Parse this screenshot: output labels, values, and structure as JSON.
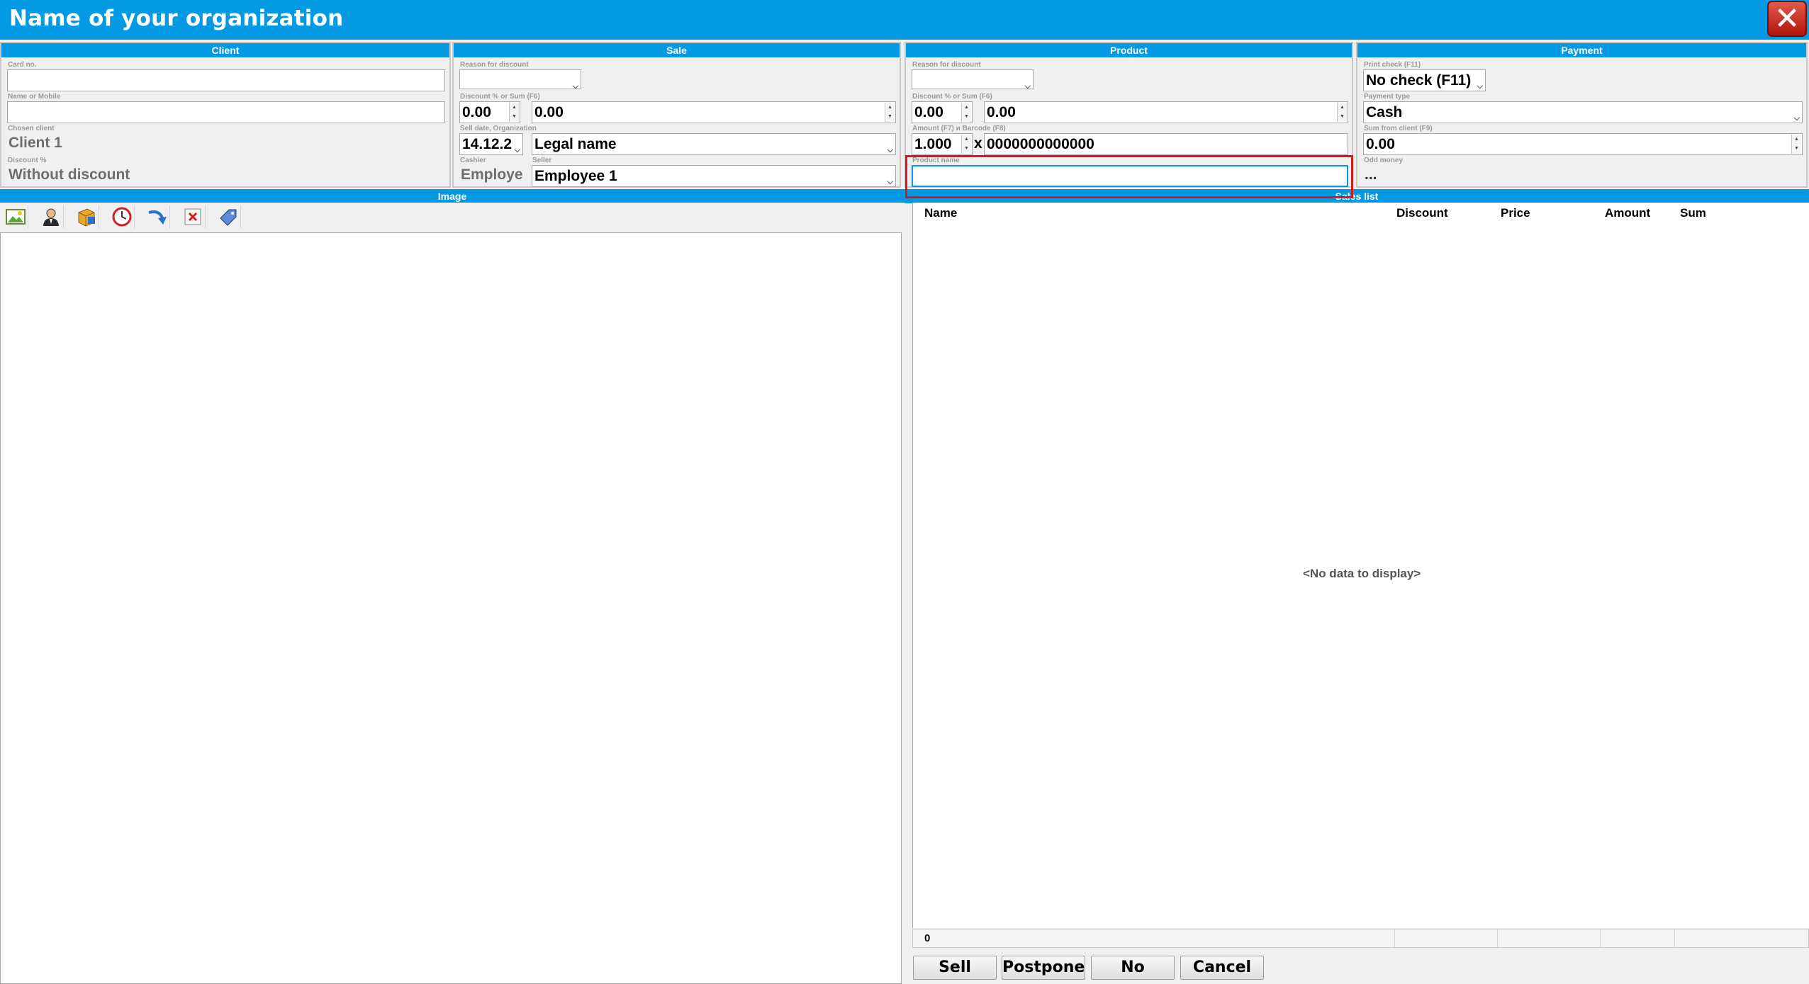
{
  "window": {
    "title": "Name of your organization"
  },
  "client": {
    "header": "Client",
    "card_label": "Card no.",
    "card_value": "",
    "name_label": "Name or Mobile",
    "name_value": "",
    "chosen_label": "Chosen client",
    "chosen_value": "Client 1",
    "discount_label": "Discount %",
    "discount_value": "Without discount"
  },
  "sale": {
    "header": "Sale",
    "reason_label": "Reason for discount",
    "reason_value": "",
    "discount_label": "Discount % or Sum (F6)",
    "discount_pct": "0.00",
    "discount_sum": "0.00",
    "date_label": "Sell date, Organization",
    "date_value": "14.12.2",
    "organization": "Legal name",
    "cashier_label": "Cashier",
    "cashier_value": "Employe",
    "seller_label": "Seller",
    "seller_value": "Employee 1"
  },
  "product": {
    "header": "Product",
    "reason_label": "Reason for discount",
    "reason_value": "",
    "discount_label": "Discount % or Sum (F6)",
    "discount_pct": "0.00",
    "discount_sum": "0.00",
    "amount_label": "Amount (F7) и Barcode (F8)",
    "amount_value": "1.000",
    "times": "x",
    "barcode": "0000000000000",
    "name_label": "Product name",
    "name_value": ""
  },
  "payment": {
    "header": "Payment",
    "print_label": "Print check (F11)",
    "print_value": "No check (F11)",
    "type_label": "Payment type",
    "type_value": "Cash",
    "sum_label": "Sum from client (F9)",
    "sum_value": "0.00",
    "odd_label": "Odd money",
    "odd_value": "..."
  },
  "sections": {
    "image": "Image",
    "sales": "Sales list"
  },
  "grid": {
    "columns": [
      "Name",
      "Discount",
      "Price",
      "Amount",
      "Sum"
    ],
    "empty_text": "<No data to display>",
    "footer_count": "0"
  },
  "actions": {
    "sell": "Sell",
    "postpone": "Postpone",
    "no": "No",
    "cancel": "Cancel"
  },
  "toolbar_icons": [
    "image-icon",
    "user-icon",
    "products-icon",
    "clock-icon",
    "return-arrow-icon",
    "delete-icon",
    "price-tag-icon"
  ],
  "colors": {
    "accent": "#0399e3",
    "highlight": "#d8161d",
    "close": "#c7251b"
  }
}
